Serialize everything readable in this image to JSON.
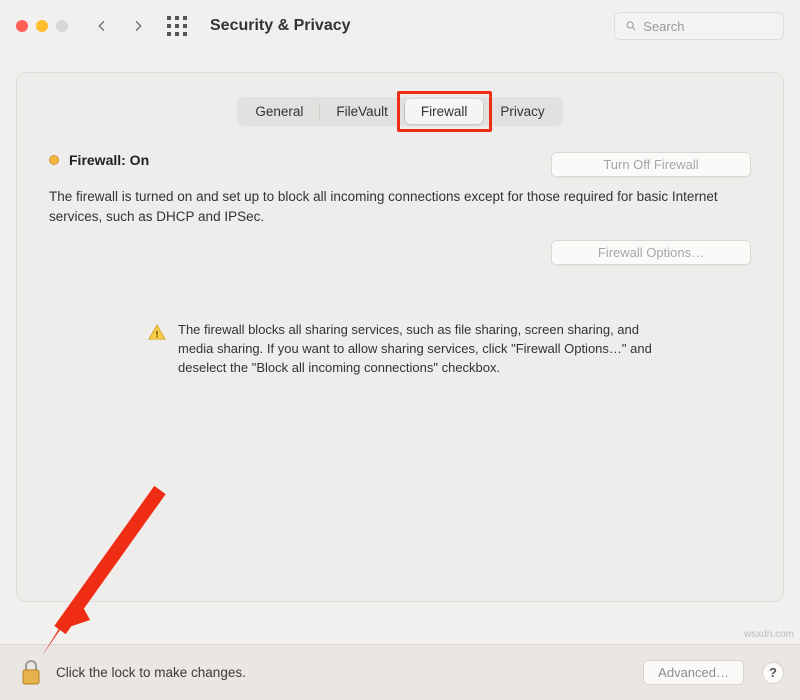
{
  "window": {
    "title": "Security & Privacy"
  },
  "search": {
    "placeholder": "Search",
    "value": ""
  },
  "tabs": {
    "general": "General",
    "filevault": "FileVault",
    "firewall": "Firewall",
    "privacy": "Privacy"
  },
  "firewall": {
    "status_label": "Firewall: On",
    "turn_off_label": "Turn Off Firewall",
    "description": "The firewall is turned on and set up to block all incoming connections except for those required for basic Internet services, such as DHCP and IPSec.",
    "options_label": "Firewall Options…",
    "info_text": "The firewall blocks all sharing services, such as file sharing, screen sharing, and media sharing. If you want to allow sharing services, click \"Firewall Options…\" and deselect the \"Block all incoming connections\" checkbox."
  },
  "footer": {
    "lock_text": "Click the lock to make changes.",
    "advanced_label": "Advanced…",
    "help_label": "?"
  },
  "watermark": "wsxdn.com"
}
